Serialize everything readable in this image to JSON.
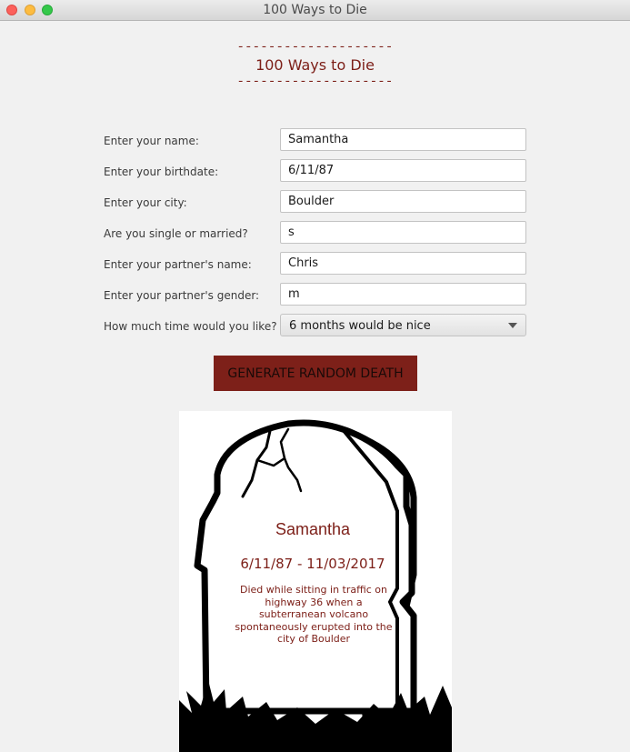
{
  "window": {
    "title": "100 Ways to Die"
  },
  "header": {
    "dashes_top": "--------------------",
    "title": "100 Ways to Die",
    "dashes_bottom": "--------------------"
  },
  "form": {
    "name": {
      "label": "Enter your name:",
      "value": "Samantha"
    },
    "birthdate": {
      "label": "Enter your birthdate:",
      "value": "6/11/87"
    },
    "city": {
      "label": "Enter your city:",
      "value": "Boulder"
    },
    "status": {
      "label": "Are you single or married?",
      "value": "s"
    },
    "partner_name": {
      "label": "Enter your partner's name:",
      "value": "Chris"
    },
    "partner_gender": {
      "label": "Enter your partner's gender:",
      "value": "m"
    },
    "time": {
      "label": "How much time would you like?",
      "value": "6 months would be nice"
    }
  },
  "generate_button": {
    "label": "GENERATE RANDOM DEATH"
  },
  "tombstone": {
    "name": "Samantha",
    "dates": "6/11/87 - 11/03/2017",
    "cause": "Died while sitting in traffic on highway 36 when a subterranean volcano spontaneously erupted into the city of Boulder"
  },
  "colors": {
    "accent": "#7d2019",
    "background": "#f1f1f1"
  }
}
